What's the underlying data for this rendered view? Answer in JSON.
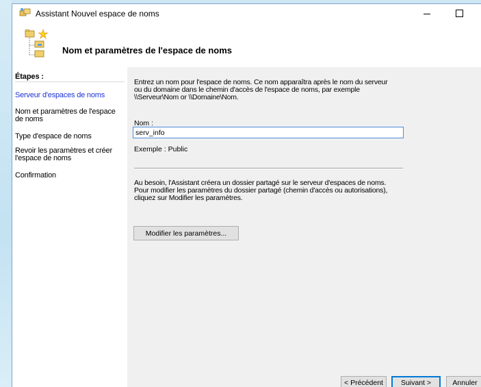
{
  "window": {
    "title": "Assistant Nouvel espace de noms"
  },
  "header": {
    "title": "Nom et paramètres de l'espace de noms"
  },
  "sidebar": {
    "heading": "Étapes :",
    "steps": [
      {
        "line1": "Serveur d'espaces de noms",
        "line2": "",
        "active": true
      },
      {
        "line1": "Nom et paramètres de l'espace",
        "line2": "de noms",
        "active": false
      },
      {
        "line1": "Type d'espace de noms",
        "line2": "",
        "active": false
      },
      {
        "line1": "Revoir les paramètres et créer",
        "line2": "l'espace de noms",
        "active": false
      },
      {
        "line1": "Confirmation",
        "line2": "",
        "active": false
      }
    ]
  },
  "content": {
    "intro": {
      "line1": "Entrez un nom pour l'espace de noms. Ce nom apparaîtra après le nom du serveur",
      "line2": "ou du domaine dans le chemin d'accès de l'espace de noms, par exemple",
      "line3": "\\\\Serveur\\Nom or \\\\Domaine\\Nom."
    },
    "name_label": "Nom :",
    "name_value": "serv_info",
    "example": "Exemple : Public",
    "note": {
      "line1": "Au besoin, l'Assistant créera un dossier partagé sur le serveur d'espaces de noms.",
      "line2": "Pour modifier les paramètres du dossier partagé (chemin d'accès ou autorisations),",
      "line3": "cliquez sur Modifier les paramètres."
    },
    "modify_button": "Modifier les paramètres..."
  },
  "footer": {
    "prev_button": "< Précédent",
    "next_button": "Suivant >",
    "cancel_button": "Annuler"
  },
  "colors": {
    "active_step": "#1b32d6",
    "input_border": "#4a8bd6",
    "content_bg": "#f0f0f0"
  }
}
